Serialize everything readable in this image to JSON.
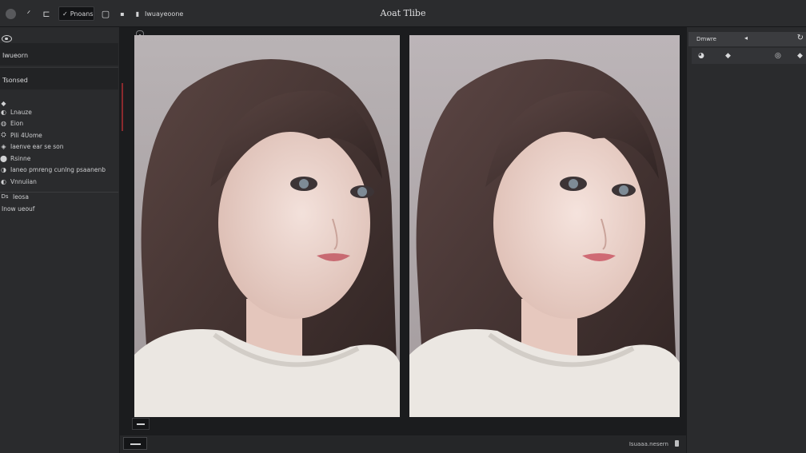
{
  "app": {
    "title": "Aoat Tlibe"
  },
  "toolbar": {
    "icons": [
      "record-icon",
      "move-icon",
      "crop-icon",
      "frame-icon",
      "delete-icon",
      "text-icon"
    ],
    "active_tool": {
      "glyph": "✓",
      "label": "Pnoans"
    },
    "file_label": "Iwuayeoone"
  },
  "left_panel": {
    "section1": "Iwueorn",
    "section2": "Tsonsed",
    "items": [
      {
        "icon": "◆",
        "label": ""
      },
      {
        "icon": "◐",
        "label": "Lnauze"
      },
      {
        "icon": "◍",
        "label": "Eion"
      },
      {
        "icon": "⛭",
        "label": "Pili 4Uome"
      },
      {
        "icon": "◈",
        "label": "Iaenve ear se son"
      },
      {
        "icon": "⬤",
        "label": "Rsinne"
      },
      {
        "icon": "◑",
        "label": "Ianeo pmreng cunlng psaanenb"
      },
      {
        "icon": "◐",
        "label": "Vnnuiian"
      }
    ],
    "footer_items": [
      {
        "icon": "Ds",
        "label": "Ieosa"
      },
      {
        "icon": "",
        "label": "Inow ueouf"
      }
    ]
  },
  "canvas": {
    "photos": [
      "portrait-original",
      "portrait-edited"
    ]
  },
  "bottom_bar": {
    "status": "Isuaaa.nesern"
  },
  "right_panel": {
    "header": "Dmwre",
    "tool_icons": [
      "pin-icon",
      "diamond-icon",
      "target-icon",
      "diamond-icon"
    ]
  },
  "colors": {
    "background": "#1f2022",
    "panel": "#2a2b2d",
    "accent_red": "#8a2a2e"
  }
}
